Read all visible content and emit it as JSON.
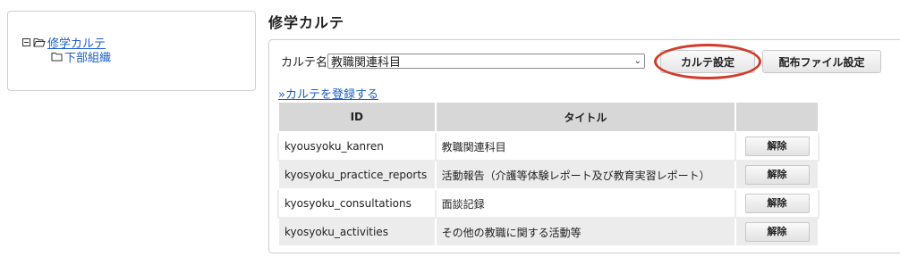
{
  "tree": {
    "root_label": "修学カルテ",
    "child_label": "下部組織"
  },
  "page": {
    "title": "修学カルテ"
  },
  "karte_select": {
    "label": "カルテ名",
    "selected": "教職関連科目"
  },
  "buttons": {
    "settings": "カルテ設定",
    "distribution": "配布ファイル設定"
  },
  "register_link": "»カルテを登録する",
  "table": {
    "headers": [
      "ID",
      "タイトル",
      ""
    ],
    "rows": [
      {
        "id": "kyousyoku_kanren",
        "title": "教職関連科目",
        "action": "解除"
      },
      {
        "id": "kyosyoku_practice_reports",
        "title": "活動報告（介護等体験レポート及び教育実習レポート）",
        "action": "解除"
      },
      {
        "id": "kyosyoku_consultations",
        "title": "面談記録",
        "action": "解除"
      },
      {
        "id": "kyosyoku_activities",
        "title": "その他の教職に関する活動等",
        "action": "解除"
      }
    ]
  },
  "colors": {
    "link": "#1a5dc8",
    "highlight": "#d23a2a",
    "header_bg": "#d7d7d7",
    "row_alt_bg": "#ececec"
  }
}
